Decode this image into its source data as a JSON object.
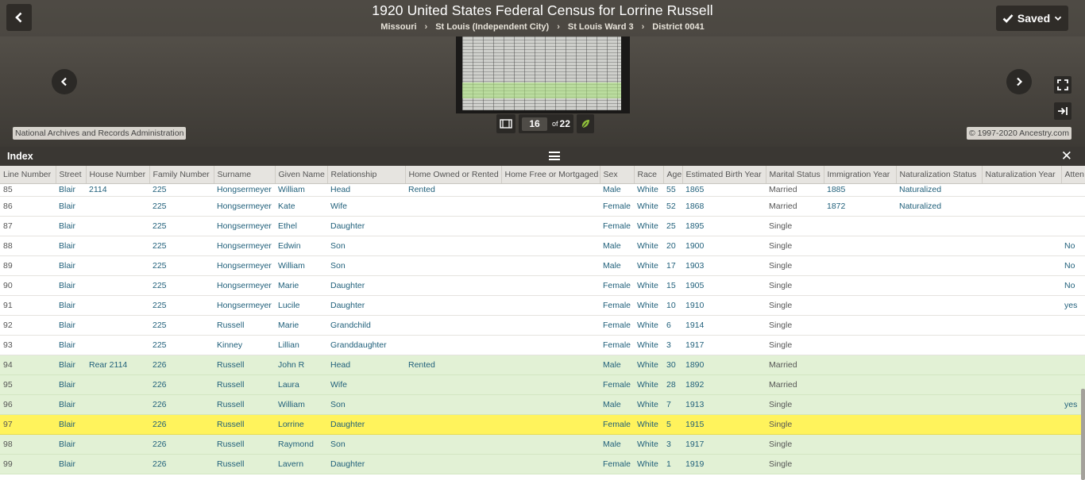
{
  "header": {
    "title": "1920 United States Federal Census for Lorrine Russell",
    "breadcrumbs": [
      "Missouri",
      "St Louis (Independent City)",
      "St Louis Ward 3",
      "District 0041"
    ],
    "saved_label": "Saved"
  },
  "viewer": {
    "source": "National Archives and Records Administration",
    "copyright": "© 1997-2020 Ancestry.com",
    "page_current": "16",
    "page_of": "of",
    "page_total": "22"
  },
  "index": {
    "title": "Index",
    "columns": [
      "Line Number",
      "Street",
      "House Number",
      "Family Number",
      "Surname",
      "Given Name",
      "Relationship",
      "Home Owned or Rented",
      "Home Free or Mortgaged",
      "Sex",
      "Race",
      "Age",
      "Estimated Birth Year",
      "Marital Status",
      "Immigration Year",
      "Naturalization Status",
      "Naturalization Year",
      "Atten"
    ],
    "rows": [
      {
        "group": "prev",
        "cells": [
          "85",
          "Blair",
          "2114",
          "225",
          "Hongsermeyer",
          "William",
          "Head",
          "Rented",
          "",
          "Male",
          "White",
          "55",
          "1865",
          "Married",
          "1885",
          "Naturalized",
          "",
          ""
        ]
      },
      {
        "group": "prev",
        "cells": [
          "86",
          "Blair",
          "",
          "225",
          "Hongsermeyer",
          "Kate",
          "Wife",
          "",
          "",
          "Female",
          "White",
          "52",
          "1868",
          "Married",
          "1872",
          "Naturalized",
          "",
          ""
        ]
      },
      {
        "group": "prev",
        "cells": [
          "87",
          "Blair",
          "",
          "225",
          "Hongsermeyer",
          "Ethel",
          "Daughter",
          "",
          "",
          "Female",
          "White",
          "25",
          "1895",
          "Single",
          "",
          "",
          "",
          ""
        ]
      },
      {
        "group": "prev",
        "cells": [
          "88",
          "Blair",
          "",
          "225",
          "Hongsermeyer",
          "Edwin",
          "Son",
          "",
          "",
          "Male",
          "White",
          "20",
          "1900",
          "Single",
          "",
          "",
          "",
          "No"
        ]
      },
      {
        "group": "prev",
        "cells": [
          "89",
          "Blair",
          "",
          "225",
          "Hongsermeyer",
          "William",
          "Son",
          "",
          "",
          "Male",
          "White",
          "17",
          "1903",
          "Single",
          "",
          "",
          "",
          "No"
        ]
      },
      {
        "group": "prev",
        "cells": [
          "90",
          "Blair",
          "",
          "225",
          "Hongsermeyer",
          "Marie",
          "Daughter",
          "",
          "",
          "Female",
          "White",
          "15",
          "1905",
          "Single",
          "",
          "",
          "",
          "No"
        ]
      },
      {
        "group": "prev",
        "cells": [
          "91",
          "Blair",
          "",
          "225",
          "Hongsermeyer",
          "Lucile",
          "Daughter",
          "",
          "",
          "Female",
          "White",
          "10",
          "1910",
          "Single",
          "",
          "",
          "",
          "yes"
        ]
      },
      {
        "group": "prev",
        "cells": [
          "92",
          "Blair",
          "",
          "225",
          "Russell",
          "Marie",
          "Grandchild",
          "",
          "",
          "Female",
          "White",
          "6",
          "1914",
          "Single",
          "",
          "",
          "",
          ""
        ]
      },
      {
        "group": "prev",
        "cells": [
          "93",
          "Blair",
          "",
          "225",
          "Kinney",
          "Lillian",
          "Granddaughter",
          "",
          "",
          "Female",
          "White",
          "3",
          "1917",
          "Single",
          "",
          "",
          "",
          ""
        ]
      },
      {
        "group": "current",
        "cells": [
          "94",
          "Blair",
          "Rear 2114",
          "226",
          "Russell",
          "John R",
          "Head",
          "Rented",
          "",
          "Male",
          "White",
          "30",
          "1890",
          "Married",
          "",
          "",
          "",
          ""
        ]
      },
      {
        "group": "current",
        "cells": [
          "95",
          "Blair",
          "",
          "226",
          "Russell",
          "Laura",
          "Wife",
          "",
          "",
          "Female",
          "White",
          "28",
          "1892",
          "Married",
          "",
          "",
          "",
          ""
        ]
      },
      {
        "group": "current",
        "cells": [
          "96",
          "Blair",
          "",
          "226",
          "Russell",
          "William",
          "Son",
          "",
          "",
          "Male",
          "White",
          "7",
          "1913",
          "Single",
          "",
          "",
          "",
          "yes"
        ]
      },
      {
        "group": "selected",
        "cells": [
          "97",
          "Blair",
          "",
          "226",
          "Russell",
          "Lorrine",
          "Daughter",
          "",
          "",
          "Female",
          "White",
          "5",
          "1915",
          "Single",
          "",
          "",
          "",
          ""
        ]
      },
      {
        "group": "current",
        "cells": [
          "98",
          "Blair",
          "",
          "226",
          "Russell",
          "Raymond",
          "Son",
          "",
          "",
          "Male",
          "White",
          "3",
          "1917",
          "Single",
          "",
          "",
          "",
          ""
        ]
      },
      {
        "group": "current",
        "cells": [
          "99",
          "Blair",
          "",
          "226",
          "Russell",
          "Lavern",
          "Daughter",
          "",
          "",
          "Female",
          "White",
          "1",
          "1919",
          "Single",
          "",
          "",
          "",
          ""
        ]
      }
    ]
  },
  "colors": {
    "household_highlight": "#e2f1d5",
    "selected_row": "#fff35c",
    "link_text": "#1f5f7a"
  },
  "icons": {
    "back": "chevron-left-icon",
    "saved": "check-icon",
    "prev_image": "chevron-left-icon",
    "next_image": "chevron-right-icon",
    "fullscreen": "fullscreen-icon",
    "panel": "panel-collapse-icon",
    "filmstrip": "filmstrip-icon",
    "leaf": "leaf-icon",
    "menu": "hamburger-icon",
    "close": "close-icon"
  }
}
